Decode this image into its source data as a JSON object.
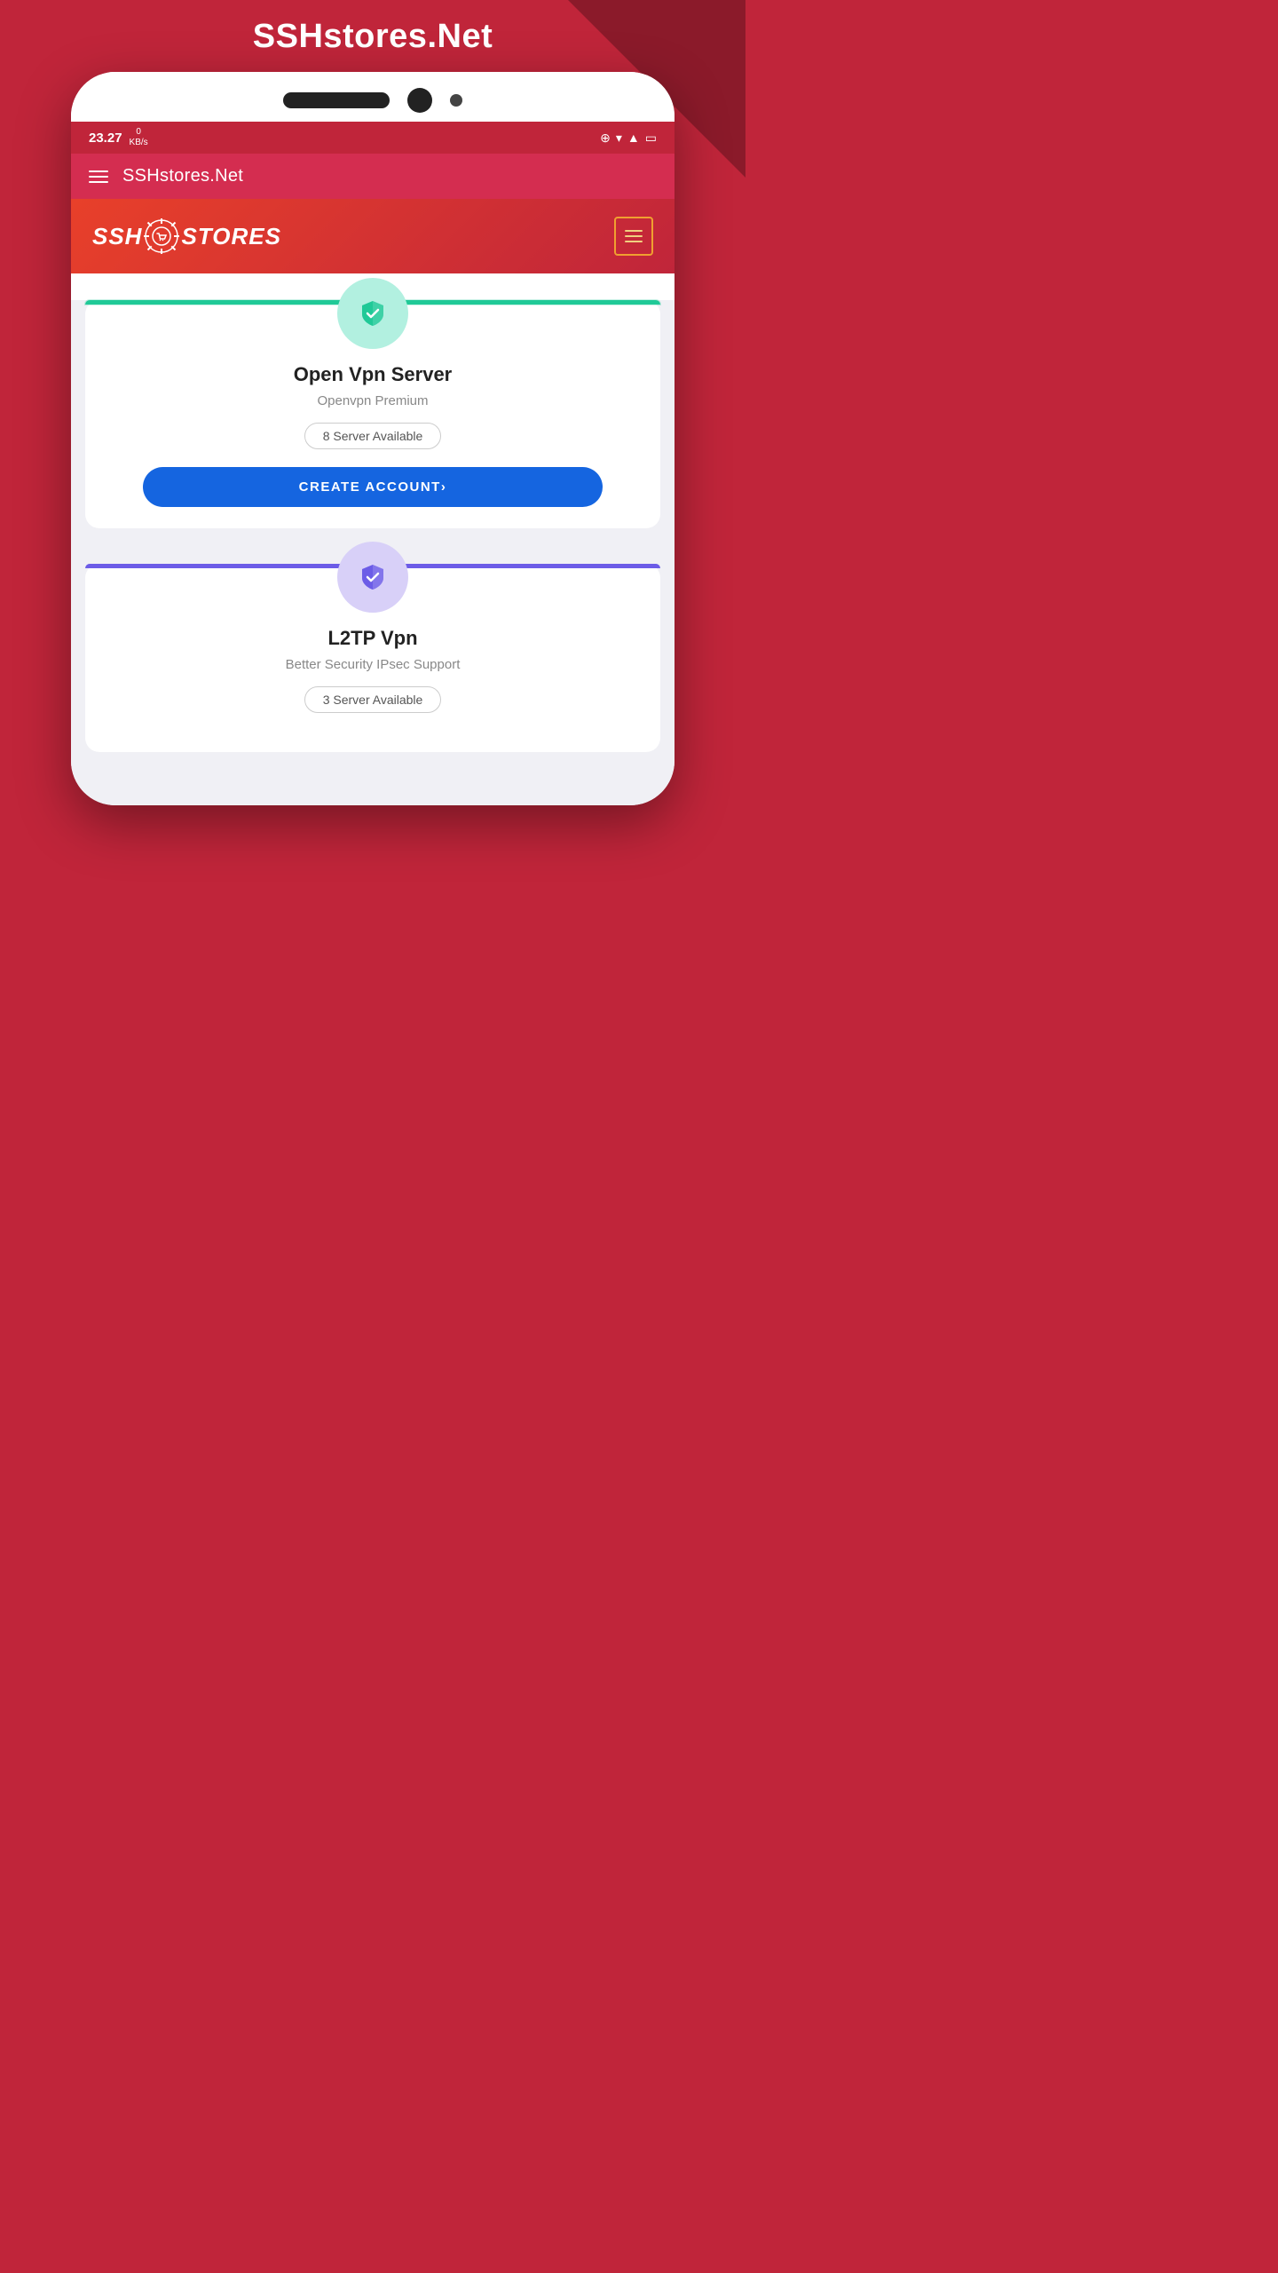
{
  "page": {
    "background_title": "SSHstores.Net",
    "app_bar": {
      "title": "SSHstores.Net"
    },
    "status_bar": {
      "time": "23.27",
      "data_value": "0",
      "data_unit": "KB/s"
    },
    "hero": {
      "logo_ssh": "SSH",
      "logo_stores": "STORES"
    },
    "card1": {
      "title": "Open Vpn Server",
      "subtitle": "Openvpn Premium",
      "badge": "8 Server Available",
      "button": "CREATE ACCOUNT›",
      "color": "green"
    },
    "card2": {
      "title": "L2TP Vpn",
      "subtitle": "Better Security IPsec Support",
      "badge": "3 Server Available",
      "color": "purple"
    }
  }
}
